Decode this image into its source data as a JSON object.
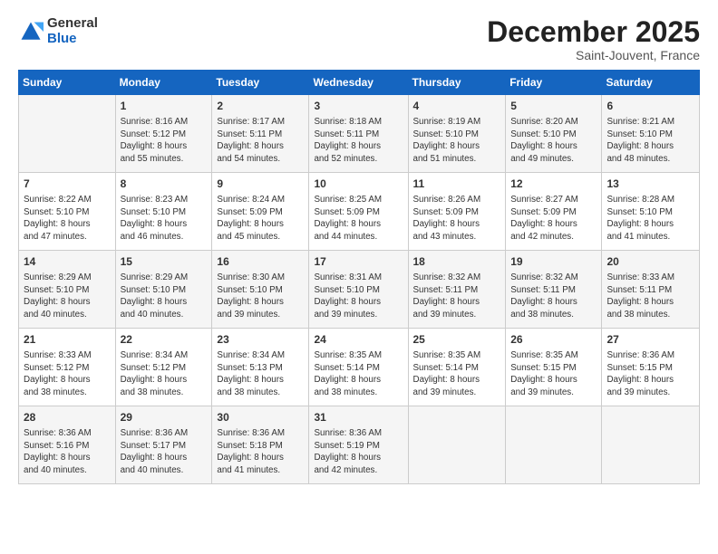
{
  "logo": {
    "general": "General",
    "blue": "Blue"
  },
  "title": "December 2025",
  "subtitle": "Saint-Jouvent, France",
  "days_header": [
    "Sunday",
    "Monday",
    "Tuesday",
    "Wednesday",
    "Thursday",
    "Friday",
    "Saturday"
  ],
  "weeks": [
    [
      {
        "day": "",
        "content": ""
      },
      {
        "day": "1",
        "content": "Sunrise: 8:16 AM\nSunset: 5:12 PM\nDaylight: 8 hours\nand 55 minutes."
      },
      {
        "day": "2",
        "content": "Sunrise: 8:17 AM\nSunset: 5:11 PM\nDaylight: 8 hours\nand 54 minutes."
      },
      {
        "day": "3",
        "content": "Sunrise: 8:18 AM\nSunset: 5:11 PM\nDaylight: 8 hours\nand 52 minutes."
      },
      {
        "day": "4",
        "content": "Sunrise: 8:19 AM\nSunset: 5:10 PM\nDaylight: 8 hours\nand 51 minutes."
      },
      {
        "day": "5",
        "content": "Sunrise: 8:20 AM\nSunset: 5:10 PM\nDaylight: 8 hours\nand 49 minutes."
      },
      {
        "day": "6",
        "content": "Sunrise: 8:21 AM\nSunset: 5:10 PM\nDaylight: 8 hours\nand 48 minutes."
      }
    ],
    [
      {
        "day": "7",
        "content": "Sunrise: 8:22 AM\nSunset: 5:10 PM\nDaylight: 8 hours\nand 47 minutes."
      },
      {
        "day": "8",
        "content": "Sunrise: 8:23 AM\nSunset: 5:10 PM\nDaylight: 8 hours\nand 46 minutes."
      },
      {
        "day": "9",
        "content": "Sunrise: 8:24 AM\nSunset: 5:09 PM\nDaylight: 8 hours\nand 45 minutes."
      },
      {
        "day": "10",
        "content": "Sunrise: 8:25 AM\nSunset: 5:09 PM\nDaylight: 8 hours\nand 44 minutes."
      },
      {
        "day": "11",
        "content": "Sunrise: 8:26 AM\nSunset: 5:09 PM\nDaylight: 8 hours\nand 43 minutes."
      },
      {
        "day": "12",
        "content": "Sunrise: 8:27 AM\nSunset: 5:09 PM\nDaylight: 8 hours\nand 42 minutes."
      },
      {
        "day": "13",
        "content": "Sunrise: 8:28 AM\nSunset: 5:10 PM\nDaylight: 8 hours\nand 41 minutes."
      }
    ],
    [
      {
        "day": "14",
        "content": "Sunrise: 8:29 AM\nSunset: 5:10 PM\nDaylight: 8 hours\nand 40 minutes."
      },
      {
        "day": "15",
        "content": "Sunrise: 8:29 AM\nSunset: 5:10 PM\nDaylight: 8 hours\nand 40 minutes."
      },
      {
        "day": "16",
        "content": "Sunrise: 8:30 AM\nSunset: 5:10 PM\nDaylight: 8 hours\nand 39 minutes."
      },
      {
        "day": "17",
        "content": "Sunrise: 8:31 AM\nSunset: 5:10 PM\nDaylight: 8 hours\nand 39 minutes."
      },
      {
        "day": "18",
        "content": "Sunrise: 8:32 AM\nSunset: 5:11 PM\nDaylight: 8 hours\nand 39 minutes."
      },
      {
        "day": "19",
        "content": "Sunrise: 8:32 AM\nSunset: 5:11 PM\nDaylight: 8 hours\nand 38 minutes."
      },
      {
        "day": "20",
        "content": "Sunrise: 8:33 AM\nSunset: 5:11 PM\nDaylight: 8 hours\nand 38 minutes."
      }
    ],
    [
      {
        "day": "21",
        "content": "Sunrise: 8:33 AM\nSunset: 5:12 PM\nDaylight: 8 hours\nand 38 minutes."
      },
      {
        "day": "22",
        "content": "Sunrise: 8:34 AM\nSunset: 5:12 PM\nDaylight: 8 hours\nand 38 minutes."
      },
      {
        "day": "23",
        "content": "Sunrise: 8:34 AM\nSunset: 5:13 PM\nDaylight: 8 hours\nand 38 minutes."
      },
      {
        "day": "24",
        "content": "Sunrise: 8:35 AM\nSunset: 5:14 PM\nDaylight: 8 hours\nand 38 minutes."
      },
      {
        "day": "25",
        "content": "Sunrise: 8:35 AM\nSunset: 5:14 PM\nDaylight: 8 hours\nand 39 minutes."
      },
      {
        "day": "26",
        "content": "Sunrise: 8:35 AM\nSunset: 5:15 PM\nDaylight: 8 hours\nand 39 minutes."
      },
      {
        "day": "27",
        "content": "Sunrise: 8:36 AM\nSunset: 5:15 PM\nDaylight: 8 hours\nand 39 minutes."
      }
    ],
    [
      {
        "day": "28",
        "content": "Sunrise: 8:36 AM\nSunset: 5:16 PM\nDaylight: 8 hours\nand 40 minutes."
      },
      {
        "day": "29",
        "content": "Sunrise: 8:36 AM\nSunset: 5:17 PM\nDaylight: 8 hours\nand 40 minutes."
      },
      {
        "day": "30",
        "content": "Sunrise: 8:36 AM\nSunset: 5:18 PM\nDaylight: 8 hours\nand 41 minutes."
      },
      {
        "day": "31",
        "content": "Sunrise: 8:36 AM\nSunset: 5:19 PM\nDaylight: 8 hours\nand 42 minutes."
      },
      {
        "day": "",
        "content": ""
      },
      {
        "day": "",
        "content": ""
      },
      {
        "day": "",
        "content": ""
      }
    ]
  ]
}
